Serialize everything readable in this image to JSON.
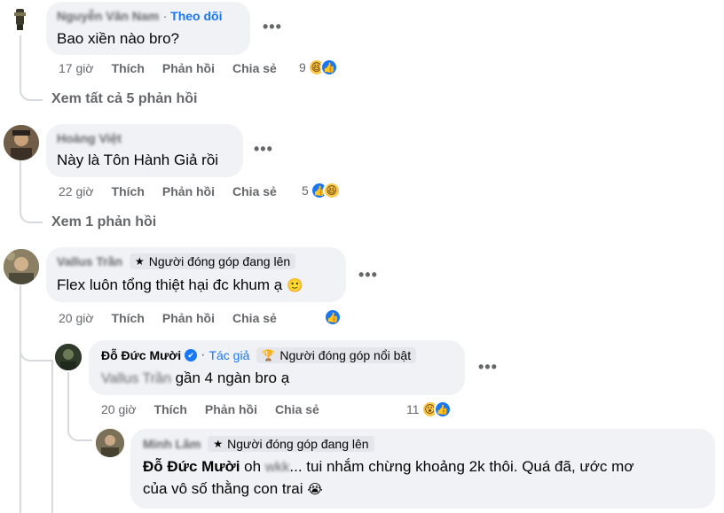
{
  "comments": [
    {
      "author": "Nguyễn Văn Nam",
      "follow_label": "Theo dõi",
      "text": "Bao xiền nào bro?",
      "time": "17 giờ",
      "like_label": "Thích",
      "reply_label": "Phản hồi",
      "share_label": "Chia sẻ",
      "reaction_count": "9",
      "reaction_icons": [
        "haha-icon",
        "like-icon"
      ],
      "view_replies": "Xem tất cả 5 phản hồi"
    },
    {
      "author": "Hoàng Việt",
      "text": "Này là Tôn Hành Giả rồi",
      "time": "22 giờ",
      "like_label": "Thích",
      "reply_label": "Phản hồi",
      "share_label": "Chia sẻ",
      "reaction_count": "5",
      "reaction_icons": [
        "like-icon",
        "haha-icon"
      ],
      "view_replies": "Xem 1 phản hồi"
    },
    {
      "author": "Vallus Trần",
      "badge": "Người đóng góp đang lên",
      "text": "Flex luôn tổng thiệt hại đc khum ạ",
      "emoji": "🙂",
      "time": "20 giờ",
      "like_label": "Thích",
      "reply_label": "Phản hồi",
      "share_label": "Chia sẻ",
      "reaction_icons": [
        "like-icon"
      ],
      "replies": [
        {
          "author": "Đỗ Đức Mười",
          "author_tag": "Tác giả",
          "badge": "Người đóng góp nổi bật",
          "mention": "Vallus Trần",
          "text": "gần 4 ngàn bro ạ",
          "time": "20 giờ",
          "like_label": "Thích",
          "reply_label": "Phản hồi",
          "share_label": "Chia sẻ",
          "reaction_count": "11",
          "reaction_icons": [
            "wow-icon",
            "like-icon"
          ]
        },
        {
          "author": "Minh Lâm",
          "badge": "Người đóng góp đang lên",
          "mention": "Đỗ Đức Mười",
          "hidden_word": "wkk",
          "text": "oh ... tui nhắm chừng khoảng 2k thôi. Quá đã, ước mơ",
          "text2": "của vô số thằng con trai",
          "emoji": "😭"
        }
      ]
    }
  ],
  "more_icon": "•••",
  "colors": {
    "accent": "#1877f2",
    "bubble": "#f0f2f5",
    "muted": "#65676b"
  }
}
